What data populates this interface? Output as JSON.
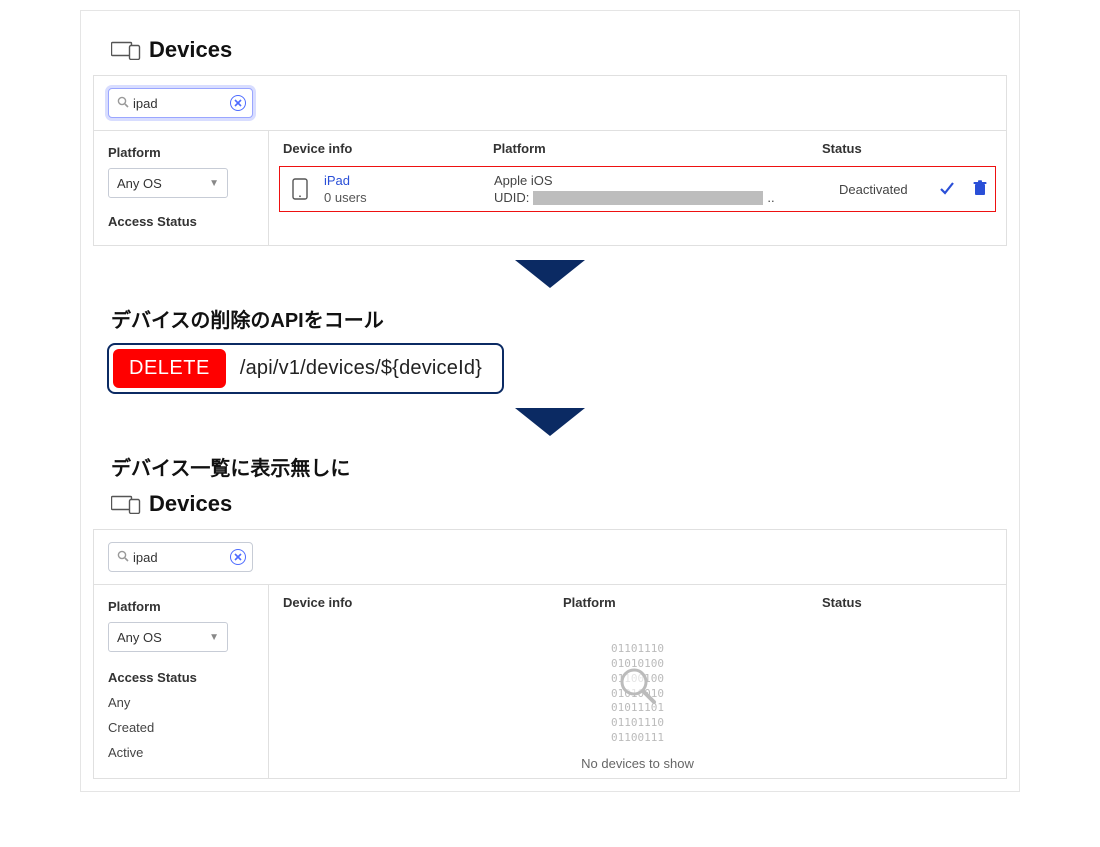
{
  "titles": {
    "devices": "Devices",
    "caption_api": "デバイスの削除のAPIをコール",
    "caption_empty": "デバイス一覧に表示無しに"
  },
  "search": {
    "value": "ipad"
  },
  "filters": {
    "platform_label": "Platform",
    "platform_value": "Any OS",
    "access_label": "Access Status",
    "items": [
      "Any",
      "Created",
      "Active"
    ]
  },
  "columns": {
    "info": "Device info",
    "platform": "Platform",
    "status": "Status"
  },
  "row": {
    "name": "iPad",
    "users": "0 users",
    "platform": "Apple iOS",
    "udid_label": "UDID:",
    "udid_suffix": "..",
    "status": "Deactivated"
  },
  "api": {
    "method": "DELETE",
    "path": "/api/v1/devices/${deviceId}"
  },
  "empty": {
    "lines": [
      "01101110",
      "01010100",
      "01100100",
      "01010010",
      "01011101",
      "01101110",
      "01100111"
    ],
    "message": "No devices to show"
  }
}
